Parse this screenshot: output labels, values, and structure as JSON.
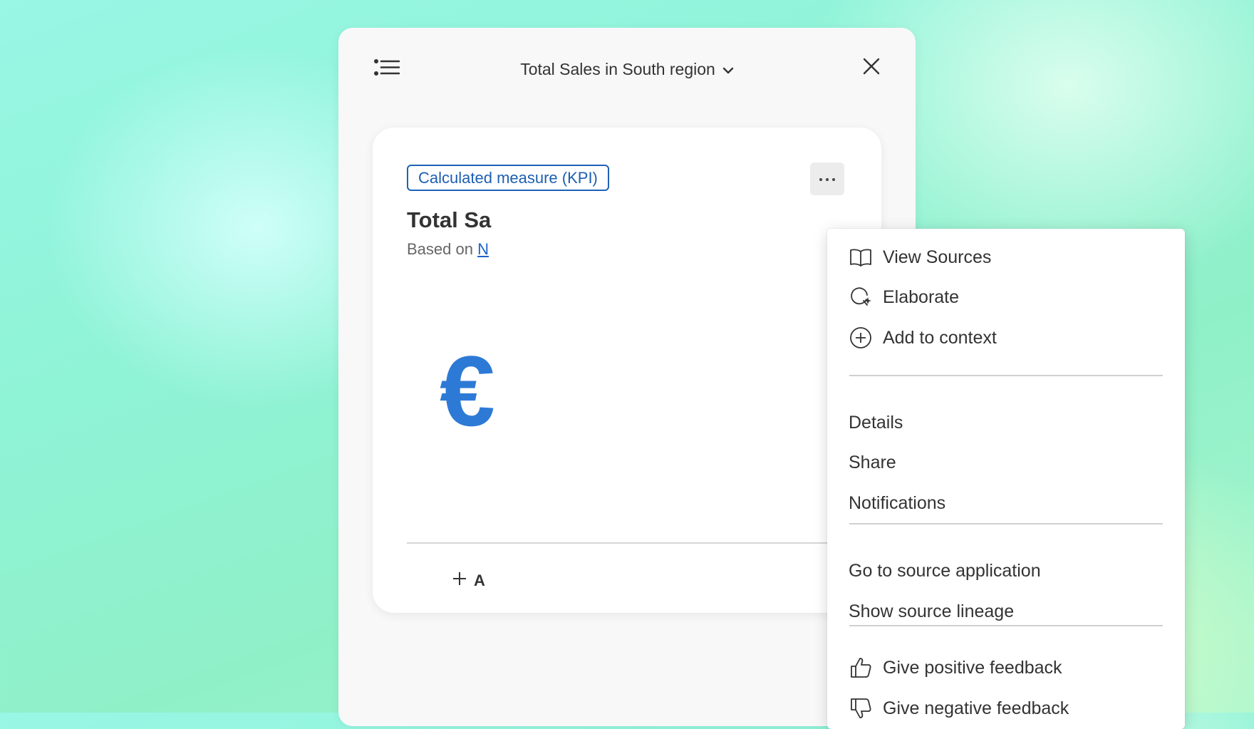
{
  "header": {
    "title": "Total Sales in South region",
    "menu_icon": "list-icon",
    "dropdown_icon": "chevron-down-icon",
    "close_icon": "close-icon"
  },
  "card": {
    "badge": "Calculated measure (KPI)",
    "title": "Total Sa",
    "subtitle_prefix": "Based on",
    "subtitle_link": "N",
    "kpi_symbol": "€",
    "add_label": "A",
    "more_icon": "more-horizontal-icon"
  },
  "menu": {
    "view_sources": "View Sources",
    "elaborate": "Elaborate",
    "add_to_context": "Add to context",
    "details": "Details",
    "share": "Share",
    "notifications": "Notifications",
    "go_to_source": "Go to source application",
    "show_lineage": "Show source lineage",
    "positive_feedback": "Give positive feedback",
    "negative_feedback": "Give negative feedback"
  },
  "colors": {
    "accent": "#1d62b8",
    "kpi_symbol": "#2d7ad6",
    "text": "#333333"
  }
}
